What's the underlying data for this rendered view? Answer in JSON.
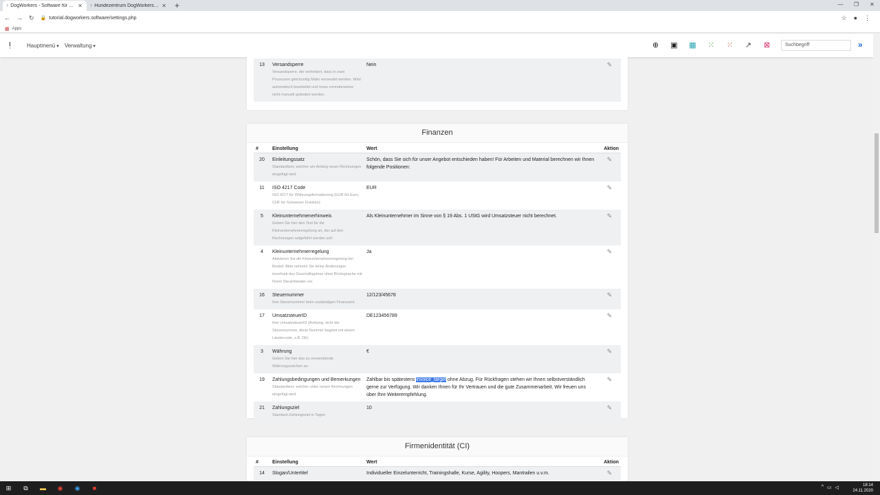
{
  "browser": {
    "tabs": [
      {
        "title": "DogWorkers - Software für die H",
        "active": true
      },
      {
        "title": "Hundezentrum DogWorkers | W",
        "active": false
      }
    ],
    "url": "tutorial.dogworkers.software/settings.php",
    "bookmarks_label": "Apps"
  },
  "nav": {
    "menu1": "Hauptmenü",
    "menu2": "Verwaltung",
    "search_placeholder": "Suchbegriff"
  },
  "top_card": {
    "rows": [
      {
        "num": "13",
        "name": "Versandsperre",
        "desc": "Versandsperre, die verhindert, dass in zwei Prozessen gleichzeitig Mails versendet werden. Wird automatisch bearbeitet und muss normalerweise nicht manuell geändert werden.",
        "value": "Nein"
      }
    ]
  },
  "finanzen": {
    "title": "Finanzen",
    "headers": {
      "num": "#",
      "setting": "Einstellung",
      "value": "Wert",
      "action": "Aktion"
    },
    "rows": [
      {
        "num": "20",
        "name": "Einleitungssatz",
        "desc": "Standardtext, welcher am Anfang neuer Rechnungen eingefügt wird.",
        "value": "Schön, dass Sie sich für unser Angebot entschieden haben! Für Arbeiten und Material berechnen wir Ihnen folgende Positionen:"
      },
      {
        "num": "11",
        "name": "ISO 4217 Code",
        "desc": "ISO 4217 für Währungsformatierung (EUR für Euro, CHF für Schweizer Franken)",
        "value": "EUR"
      },
      {
        "num": "5",
        "name": "Kleinunternehmenerhinweis",
        "desc": "Geben Sie hier den Text für die Kleinunternehmerregelung an, der auf den Rechnungen aufgeführt werden soll.",
        "value": "Als Kleinunternehmer im Sinne von § 19 Abs. 1 UStG wird Umsatzsteuer nicht berechnet."
      },
      {
        "num": "4",
        "name": "Kleinunternehmerregelung",
        "desc": "Aktivieren Sie die Kleinunternehmerregelung bei Bedarf. Bitte nehmen Sie keine Änderungen innerhalb des Geschäftsjahres ohne Rücksprache mit Ihrem Steuerberater vor.",
        "value": "Ja"
      },
      {
        "num": "16",
        "name": "Steuernummer",
        "desc": "Ihre Steuernummer beim zuständigen Finanzamt.",
        "value": "12/123/45678"
      },
      {
        "num": "17",
        "name": "UmsatzsteuerID",
        "desc": "Ihre UmsatzsteuerID (Achtung, nicht die Steuernummer, diese Nummer beginnt mit einem Ländercode, z.B. DE)",
        "value": "DE123456789"
      },
      {
        "num": "3",
        "name": "Währung",
        "desc": "Geben Sie hier das zu verwendende Währungszeichen an.",
        "value": "€"
      },
      {
        "num": "19",
        "name": "Zahlungsbedingungen und Bemerkungen",
        "desc": "Standardtext, welcher unter neuen Rechnungen eingefügt wird.",
        "value_pre": "Zahlbar bis spätestens ",
        "value_hl": "invoice_target",
        "value_post": " ohne Abzug. Für Rückfragen stehen wir Ihnen selbstverständlich gerne zur Verfügung. Wir danken Ihnen für Ihr Vertrauen und die gute Zusammenarbeit. Wir freuen uns über Ihre Weiterempfehlung."
      },
      {
        "num": "21",
        "name": "Zahlungsziel",
        "desc": "Standard-Zahlungsziel in Tagen",
        "value": "10"
      }
    ]
  },
  "firmen": {
    "title": "Firmenidentität (CI)",
    "headers": {
      "num": "#",
      "setting": "Einstellung",
      "value": "Wert",
      "action": "Aktion"
    },
    "rows": [
      {
        "num": "14",
        "name": "Slogan/Untertitel",
        "value": "Individueller Einzelunterricht, Trainingshalle, Kurse, Agility, Hoopers, Mantrailen u.v.m."
      }
    ]
  },
  "taskbar": {
    "time": "18:14",
    "date": "24.11.2020"
  }
}
